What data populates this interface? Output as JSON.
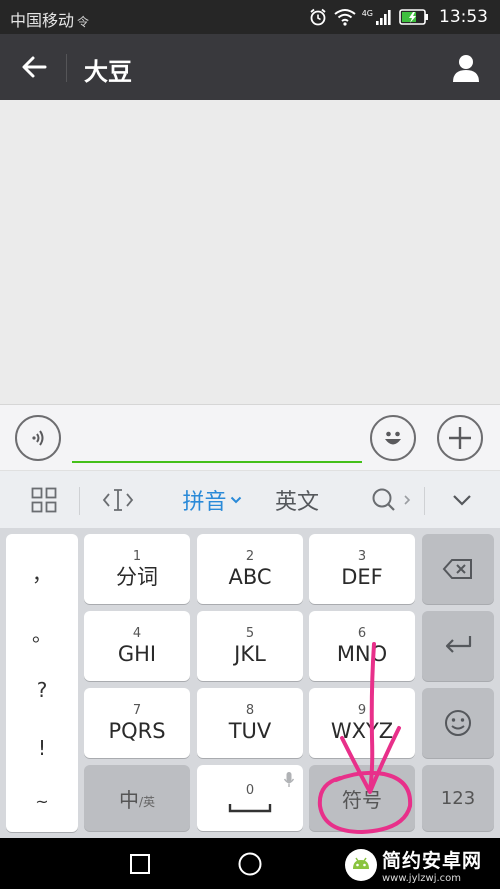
{
  "status_bar": {
    "carrier": "中国移动",
    "carrier_signal": "令",
    "network": "4G",
    "time": "13:53",
    "icons": [
      "alarm-icon",
      "wifi-icon",
      "cellular-signal-icon",
      "battery-charging-icon"
    ]
  },
  "title_bar": {
    "title": "大豆",
    "back_icon": "arrow-left-icon",
    "profile_icon": "person-icon"
  },
  "input_bar": {
    "value": "",
    "voice_icon": "voice-icon",
    "emoji_icon": "smiley-icon",
    "plus_icon": "plus-icon"
  },
  "ime_toolbar": {
    "pinyin_label": "拼音",
    "english_label": "英文",
    "active_color": "#2a8ad8"
  },
  "keyboard": {
    "punctuation": [
      "，",
      "。",
      "?",
      "!",
      "~"
    ],
    "keys": [
      {
        "num": "1",
        "letters": "分词"
      },
      {
        "num": "2",
        "letters": "ABC"
      },
      {
        "num": "3",
        "letters": "DEF"
      },
      {
        "num": "4",
        "letters": "GHI"
      },
      {
        "num": "5",
        "letters": "JKL"
      },
      {
        "num": "6",
        "letters": "MNO"
      },
      {
        "num": "7",
        "letters": "PQRS"
      },
      {
        "num": "8",
        "letters": "TUV"
      },
      {
        "num": "9",
        "letters": "WXYZ"
      }
    ],
    "zh_en_main": "中",
    "zh_en_sub": "/英",
    "space_num": "0",
    "symbol_label": "符号",
    "num_label": "123"
  },
  "annotation": {
    "color": "#e8308a"
  },
  "watermark": {
    "title": "简约安卓网",
    "url": "www.jylzwj.com"
  }
}
